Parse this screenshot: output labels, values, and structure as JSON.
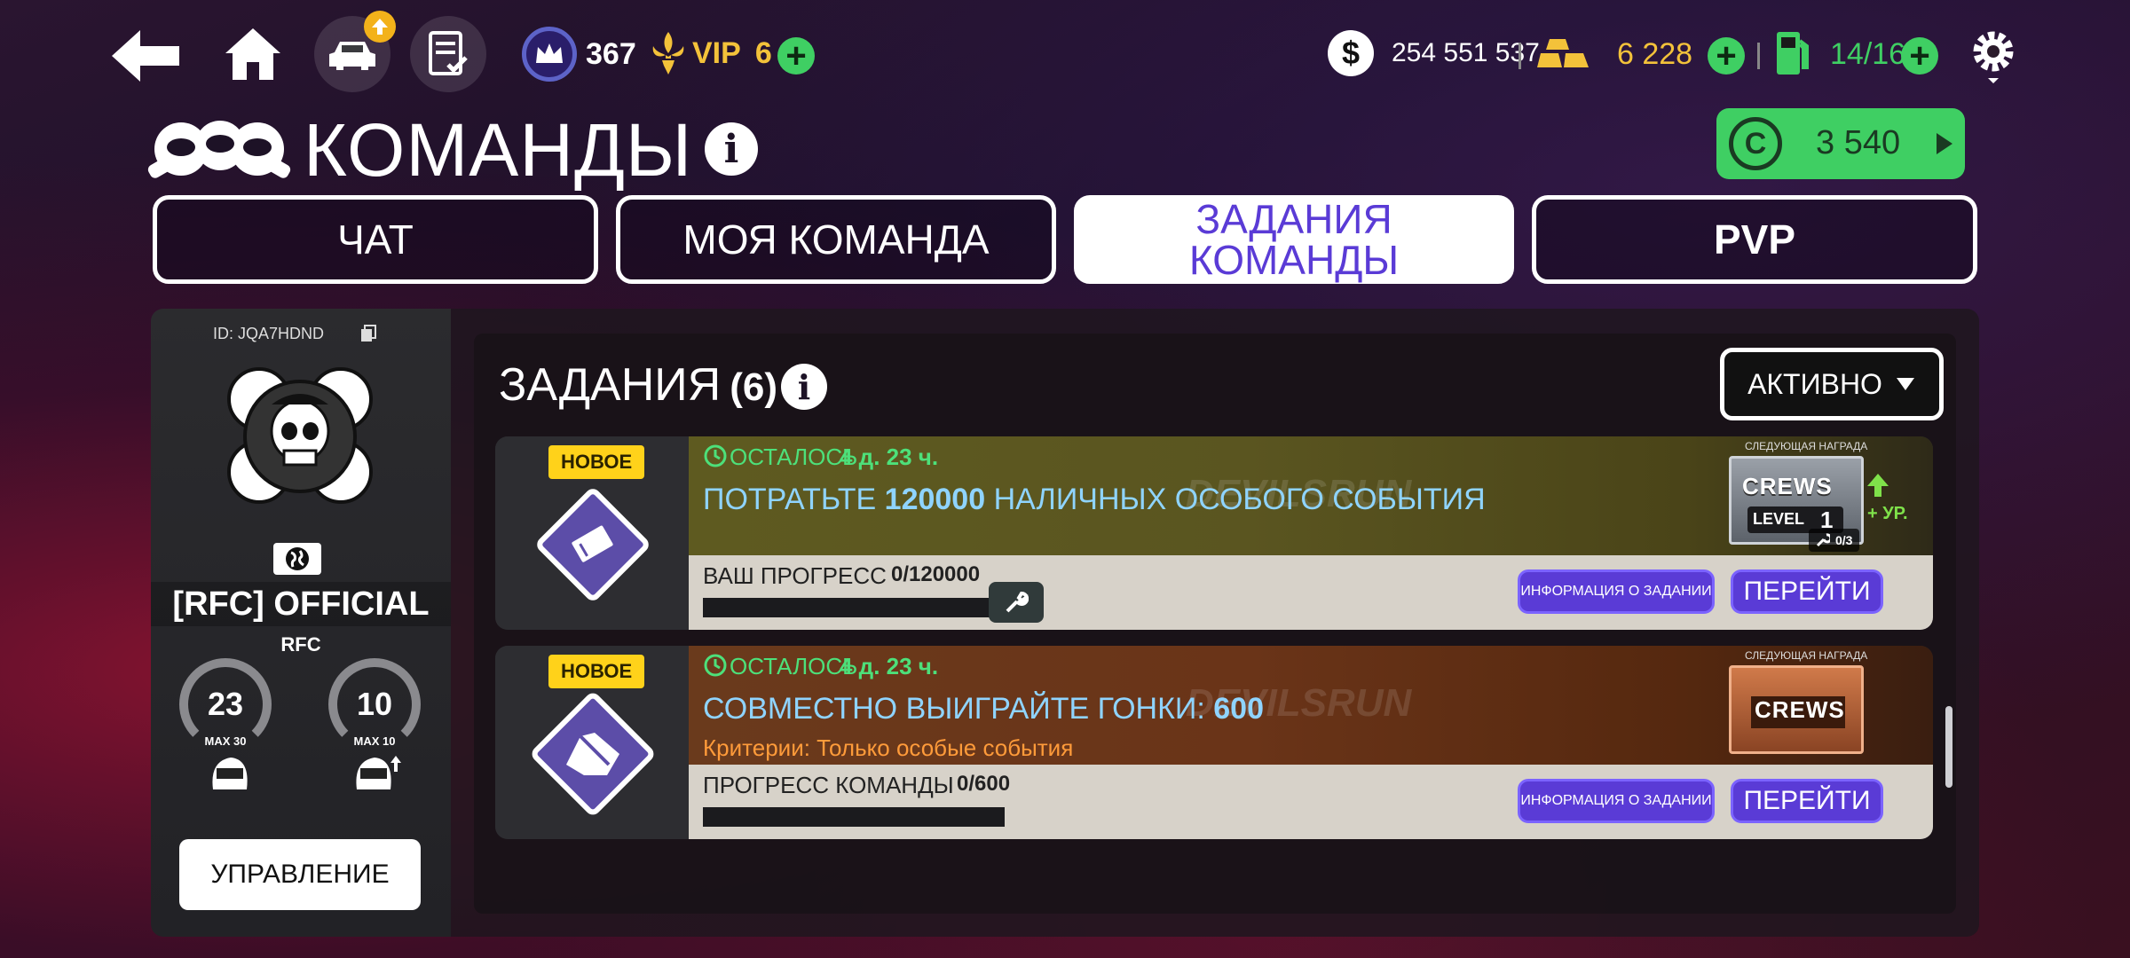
{
  "topbar": {
    "crown_value": "367",
    "vip_label": "VIP",
    "vip_level": "6",
    "cash": "254 551 537",
    "gold": "6 228",
    "fuel": "14/16",
    "crew_coins": "3 540"
  },
  "page": {
    "title": "КОМАНДЫ"
  },
  "tabs": [
    {
      "label": "ЧАТ"
    },
    {
      "label": "МОЯ КОМАНДА"
    },
    {
      "label": "ЗАДАНИЯ КОМАНДЫ"
    },
    {
      "label": "PVP"
    }
  ],
  "crew": {
    "id": "ID: JQA7HDND",
    "name": "[RFC] OFFICIAL",
    "tag": "RFC",
    "members_value": "23",
    "members_max": "MAX 30",
    "level_value": "10",
    "level_max": "MAX 10",
    "manage_label": "УПРАВЛЕНИЕ"
  },
  "missions_header": {
    "title": "ЗАДАНИЯ",
    "count": "(6)",
    "filter_label": "АКТИВНО"
  },
  "missions": [
    {
      "badge": "НОВОЕ",
      "remaining_label": "ОСТАЛОСЬ",
      "remaining_time": "4 д. 23 ч.",
      "title_pre": "ПОТРАТЬТЕ ",
      "title_num": "120000",
      "title_post": " НАЛИЧНЫХ ОСОБОГО СОБЫТИЯ",
      "progress_label": "ВАШ ПРОГРЕСС",
      "progress_value": "0/120000",
      "progress_fraction": 0,
      "reward_label": "СЛЕДУЮЩАЯ НАГРАДА",
      "reward_name": "CREWS",
      "reward_level_label": "LEVEL",
      "reward_level": "1",
      "reward_plus": "+ УР.",
      "reward_keys": "0/3",
      "info_label": "ИНФОРМАЦИЯ О ЗАДАНИИ",
      "go_label": "ПЕРЕЙТИ"
    },
    {
      "badge": "НОВОЕ",
      "remaining_label": "ОСТАЛОСЬ",
      "remaining_time": "4 д. 23 ч.",
      "title_pre": "СОВМЕСТНО ВЫИГРАЙТЕ ГОНКИ: ",
      "title_num": "600",
      "title_post": "",
      "criteria": "Критерии: Только особые события",
      "progress_label": "ПРОГРЕСС КОМАНДЫ",
      "progress_value": "0/600",
      "progress_fraction": 0,
      "reward_label": "СЛЕДУЮЩАЯ НАГРАДА",
      "reward_name": "CREWS",
      "info_label": "ИНФОРМАЦИЯ О ЗАДАНИИ",
      "go_label": "ПЕРЕЙТИ"
    }
  ],
  "colors": {
    "accent_purple": "#5a3bd6",
    "tab_active_text": "#5a3bd6",
    "green": "#3fcf63",
    "gold": "#f3c23a",
    "mission_title": "#8fd4ff",
    "criteria": "#ff9b3a",
    "new_badge": "#ffd21a"
  }
}
